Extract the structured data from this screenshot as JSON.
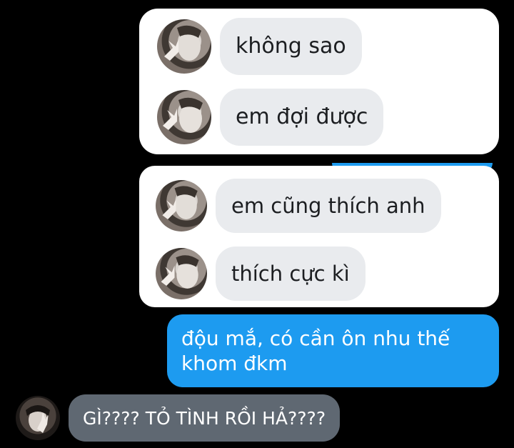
{
  "screenshot_1": {
    "messages": [
      {
        "text": "không sao"
      },
      {
        "text": "em đợi được"
      }
    ]
  },
  "screenshot_2": {
    "messages": [
      {
        "text": "em cũng thích anh"
      },
      {
        "text": "thích cực kì"
      }
    ]
  },
  "sent_message": {
    "text": "độu mắ, có cần ôn nhu thế khom đkm"
  },
  "bottom_message": {
    "text": "GÌ???? TỎ TÌNH RỒI HẢ????"
  },
  "colors": {
    "background": "#000000",
    "card": "#ffffff",
    "received_bubble": "#e9ebee",
    "sent_bubble": "#1d9bf0",
    "dark_bubble": "#5f6872"
  }
}
